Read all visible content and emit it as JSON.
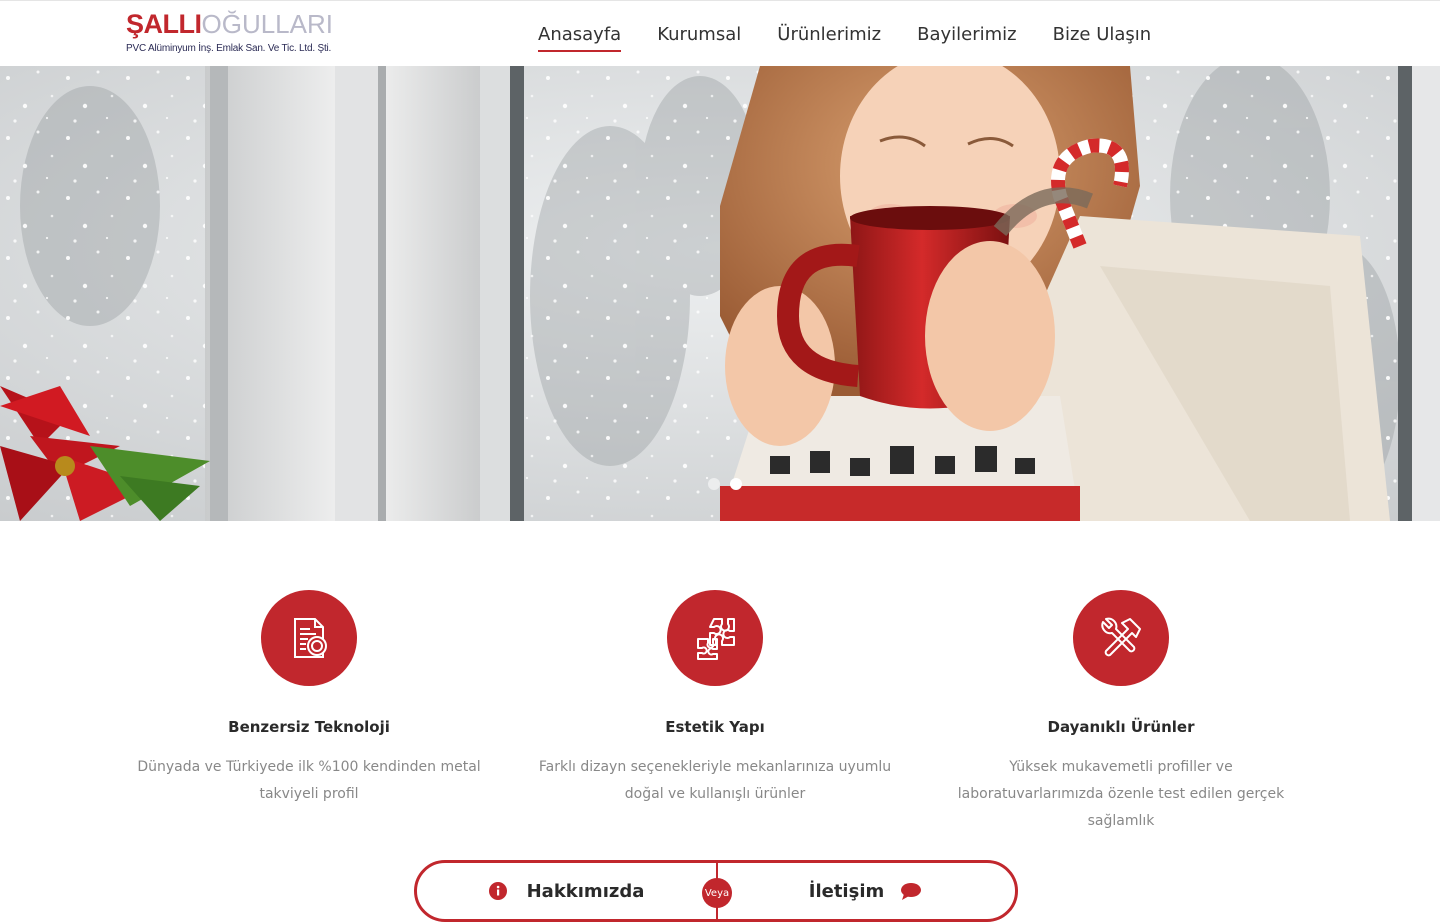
{
  "brand": {
    "name_bold": "ŞALLI",
    "name_light": "OĞULLARI",
    "tagline": "PVC Alüminyum İnş. Emlak San. Ve Tic. Ltd. Şti."
  },
  "nav": {
    "items": [
      {
        "label": "Anasayfa",
        "active": true
      },
      {
        "label": "Kurumsal"
      },
      {
        "label": "Ürünlerimiz"
      },
      {
        "label": "Bayilerimiz"
      },
      {
        "label": "Bize Ulaşın"
      }
    ]
  },
  "hero": {
    "image": "girl-with-red-mug-winter-window",
    "slides": 2,
    "active_slide": 2
  },
  "features": [
    {
      "icon": "certificate-document-icon",
      "title": "Benzersiz Teknoloji",
      "desc": "Dünyada ve Türkiyede ilk %100 kendinden metal takviyeli profil"
    },
    {
      "icon": "puzzle-icon",
      "title": "Estetik Yapı",
      "desc": "Farklı dizayn seçenekleriyle mekanlarınıza uyumlu doğal ve kullanışlı ürünler"
    },
    {
      "icon": "tools-icon",
      "title": "Dayanıklı Ürünler",
      "desc": "Yüksek mukavemetli profiller ve laboratuvarlarımızda özenle test edilen gerçek sağlamlık"
    }
  ],
  "cta": {
    "left_label": "Hakkımızda",
    "left_icon": "info-icon",
    "or_label": "Veya",
    "right_label": "İletişim",
    "right_icon": "chat-bubble-icon"
  },
  "colors": {
    "accent": "#c1272d",
    "text": "#333333",
    "muted": "#888888"
  }
}
